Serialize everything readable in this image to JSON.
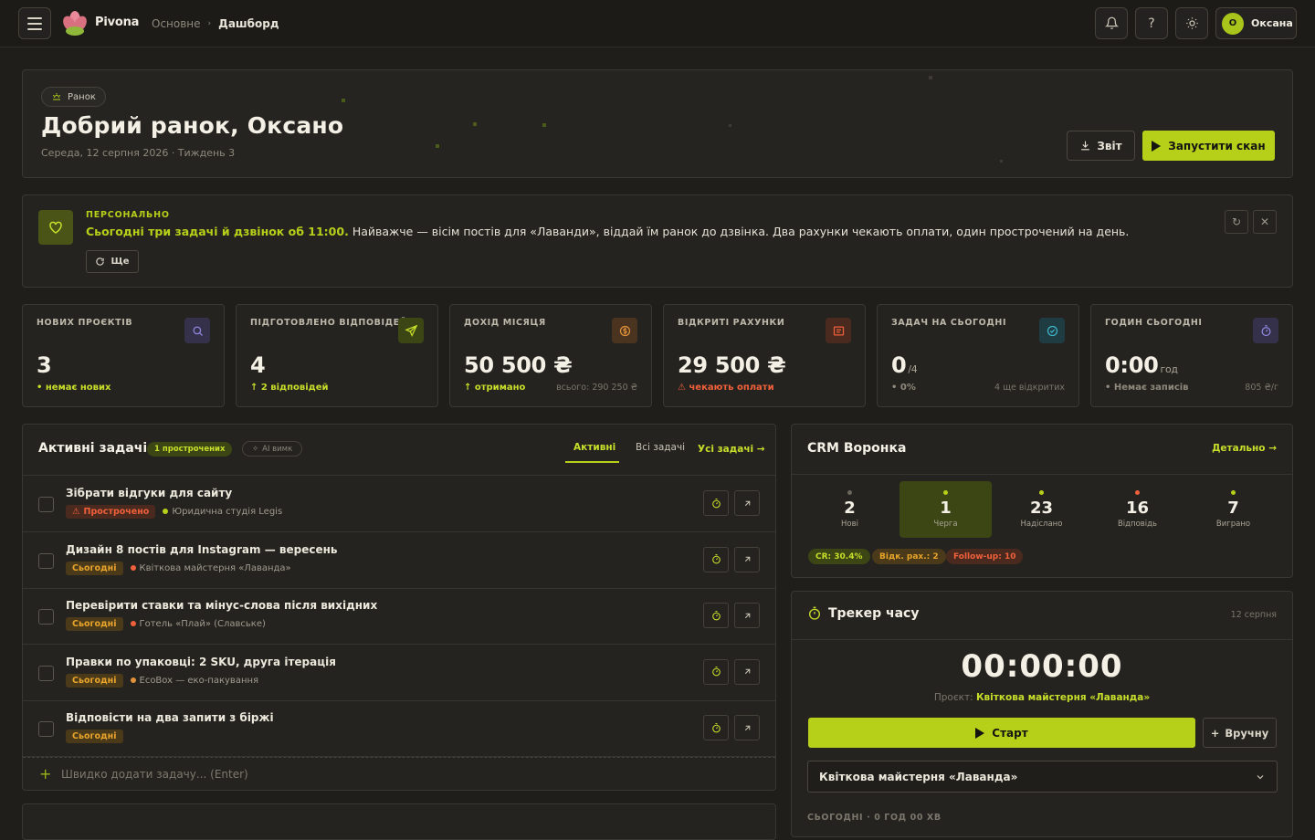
{
  "brand": "Pivona",
  "breadcrumb": {
    "root": "Основне",
    "current": "Дашборд"
  },
  "user": {
    "initial": "О",
    "name": "Оксана"
  },
  "hero": {
    "chip": "Ранок",
    "greeting": "Добрий ранок, Оксано",
    "date": "Середа, 12 серпня 2026 · Тиждень 3",
    "report_label": "Звіт",
    "scan_label": "Запустити скан"
  },
  "personal": {
    "label": "ПЕРСОНАЛЬНО",
    "highlight": "Сьогодні три задачі й дзвінок об 11:00.",
    "text": " Найважче — вісім постів для «Лаванди», віддай їм ранок до дзвінка. Два рахунки чекають оплати, один прострочений на день.",
    "more": "Ще"
  },
  "stats": [
    {
      "label": "НОВИХ ПРОЄКТІВ",
      "value": "3",
      "unit": "",
      "sub": "• немає нових",
      "aux": "",
      "icon": "search-icon",
      "color": "#8f88e0",
      "bg": "#35314a",
      "subcolor": "#c7df2a"
    },
    {
      "label": "ПІДГОТОВЛЕНО ВІДПОВІДЕЙ",
      "value": "4",
      "unit": "",
      "sub": "↑ 2 відповідей",
      "aux": "",
      "icon": "send-icon",
      "color": "#c7df2a",
      "bg": "#3c4614",
      "subcolor": "#c7df2a"
    },
    {
      "label": "ДОХІД МІСЯЦЯ",
      "value": "50 500 ₴",
      "unit": "",
      "sub": "↑ отримано",
      "aux": "всього: 290 250 ₴",
      "icon": "coin-icon",
      "color": "#e0913a",
      "bg": "#4a3420",
      "subcolor": "#c7df2a"
    },
    {
      "label": "ВІДКРИТІ РАХУНКИ",
      "value": "29 500 ₴",
      "unit": "",
      "sub": "⚠ чекають оплати",
      "aux": "",
      "icon": "invoice-icon",
      "color": "#f0603a",
      "bg": "#4a2a1f",
      "subcolor": "#f0603a"
    },
    {
      "label": "ЗАДАЧ НА СЬОГОДНІ",
      "value": "0",
      "unit": "/4",
      "sub": "• 0%",
      "aux": "4 ще відкритих",
      "icon": "check-circle-icon",
      "color": "#3fb5c8",
      "bg": "#1f3c42",
      "subcolor": "#8e897c"
    },
    {
      "label": "ГОДИН СЬОГОДНІ",
      "value": "0:00",
      "unit": "год",
      "sub": "• Немає записів",
      "aux": "805 ₴/г",
      "icon": "stopwatch-icon",
      "color": "#8f88e0",
      "bg": "#35314a",
      "subcolor": "#8e897c"
    }
  ],
  "tasks": {
    "title": "Активні задачі",
    "overdue_badge": "1 прострочених",
    "ai_badge": "AI вимк",
    "tabs": [
      "Активні",
      "Всі задачі"
    ],
    "all_link": "Усі задачі",
    "items": [
      {
        "title": "Зібрати відгуки для сайту",
        "tag": "Прострочено",
        "tag_type": "over",
        "client": "Юридична студія Legis",
        "dot": "#b6d01a"
      },
      {
        "title": "Дизайн 8 постів для Instagram — вересень",
        "tag": "Сьогодні",
        "tag_type": "today",
        "client": "Квіткова майстерня «Лаванда»",
        "dot": "#f0603a"
      },
      {
        "title": "Перевірити ставки та мінус-слова після вихідних",
        "tag": "Сьогодні",
        "tag_type": "today",
        "client": "Готель «Плай» (Славське)",
        "dot": "#f0603a"
      },
      {
        "title": "Правки по упаковці: 2 SKU, друга ітерація",
        "tag": "Сьогодні",
        "tag_type": "today",
        "client": "EcoBox — еко-пакування",
        "dot": "#e0913a"
      },
      {
        "title": "Відповісти на два запити з біржі",
        "tag": "Сьогодні",
        "tag_type": "today",
        "client": "",
        "dot": ""
      }
    ],
    "quick_placeholder": "Швидко додати задачу... (Enter)"
  },
  "crm": {
    "title": "CRM Воронка",
    "details": "Детально",
    "stages": [
      {
        "n": "2",
        "l": "Нові",
        "c": "#6a665c"
      },
      {
        "n": "1",
        "l": "Черга",
        "c": "#b6d01a"
      },
      {
        "n": "23",
        "l": "Надіслано",
        "c": "#b6d01a"
      },
      {
        "n": "16",
        "l": "Відповідь",
        "c": "#f0603a"
      },
      {
        "n": "7",
        "l": "Виграно",
        "c": "#b6d01a"
      }
    ],
    "pills": [
      {
        "t": "CR: 30.4%",
        "fg": "#c7df2a",
        "bg": "#3c4614"
      },
      {
        "t": "Відк. рах.: 2",
        "fg": "#e9a42a",
        "bg": "#4a3a1a"
      },
      {
        "t": "Follow-up: 10",
        "fg": "#f0603a",
        "bg": "#4a2a1f"
      }
    ]
  },
  "tracker": {
    "title": "Трекер часу",
    "date": "12 серпня",
    "time": "00:00:00",
    "project_label": "Проєкт:",
    "project": "Квіткова майстерня «Лаванда»",
    "start": "Старт",
    "manual": "Вручну",
    "select": "Квіткова майстерня «Лаванда»",
    "today": "СЬОГОДНІ · 0 ГОД 00 ХВ"
  }
}
